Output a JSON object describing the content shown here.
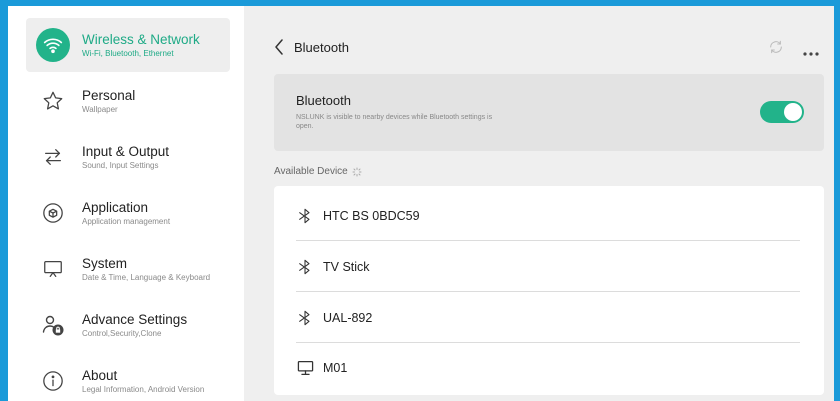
{
  "sidebar": {
    "items": [
      {
        "title": "Wireless & Network",
        "subtitle": "Wi-Fi, Bluetooth, Ethernet",
        "icon": "wifi-icon",
        "active": true
      },
      {
        "title": "Personal",
        "subtitle": "Wallpaper",
        "icon": "star-icon"
      },
      {
        "title": "Input & Output",
        "subtitle": "Sound, Input Settings",
        "icon": "arrows-swap-icon"
      },
      {
        "title": "Application",
        "subtitle": "Application management",
        "icon": "cube-icon"
      },
      {
        "title": "System",
        "subtitle": "Date & Time, Language & Keyboard",
        "icon": "display-icon"
      },
      {
        "title": "Advance Settings",
        "subtitle": "Control,Security,Clone",
        "icon": "user-lock-icon"
      },
      {
        "title": "About",
        "subtitle": "Legal Information, Android Version",
        "icon": "info-icon"
      }
    ]
  },
  "header": {
    "title": "Bluetooth"
  },
  "bluetooth": {
    "title": "Bluetooth",
    "description": "NSLUNK is visible to nearby devices while Bluetooth settings is open.",
    "enabled": true
  },
  "available": {
    "label": "Available Device"
  },
  "devices": [
    {
      "name": "HTC BS 0BDC59",
      "icon": "bluetooth-icon"
    },
    {
      "name": "TV Stick",
      "icon": "bluetooth-icon"
    },
    {
      "name": "UAL-892",
      "icon": "bluetooth-icon"
    },
    {
      "name": "M01",
      "icon": "monitor-icon"
    }
  ],
  "colors": {
    "accent": "#22b38a",
    "frame": "#1a9ad9"
  }
}
